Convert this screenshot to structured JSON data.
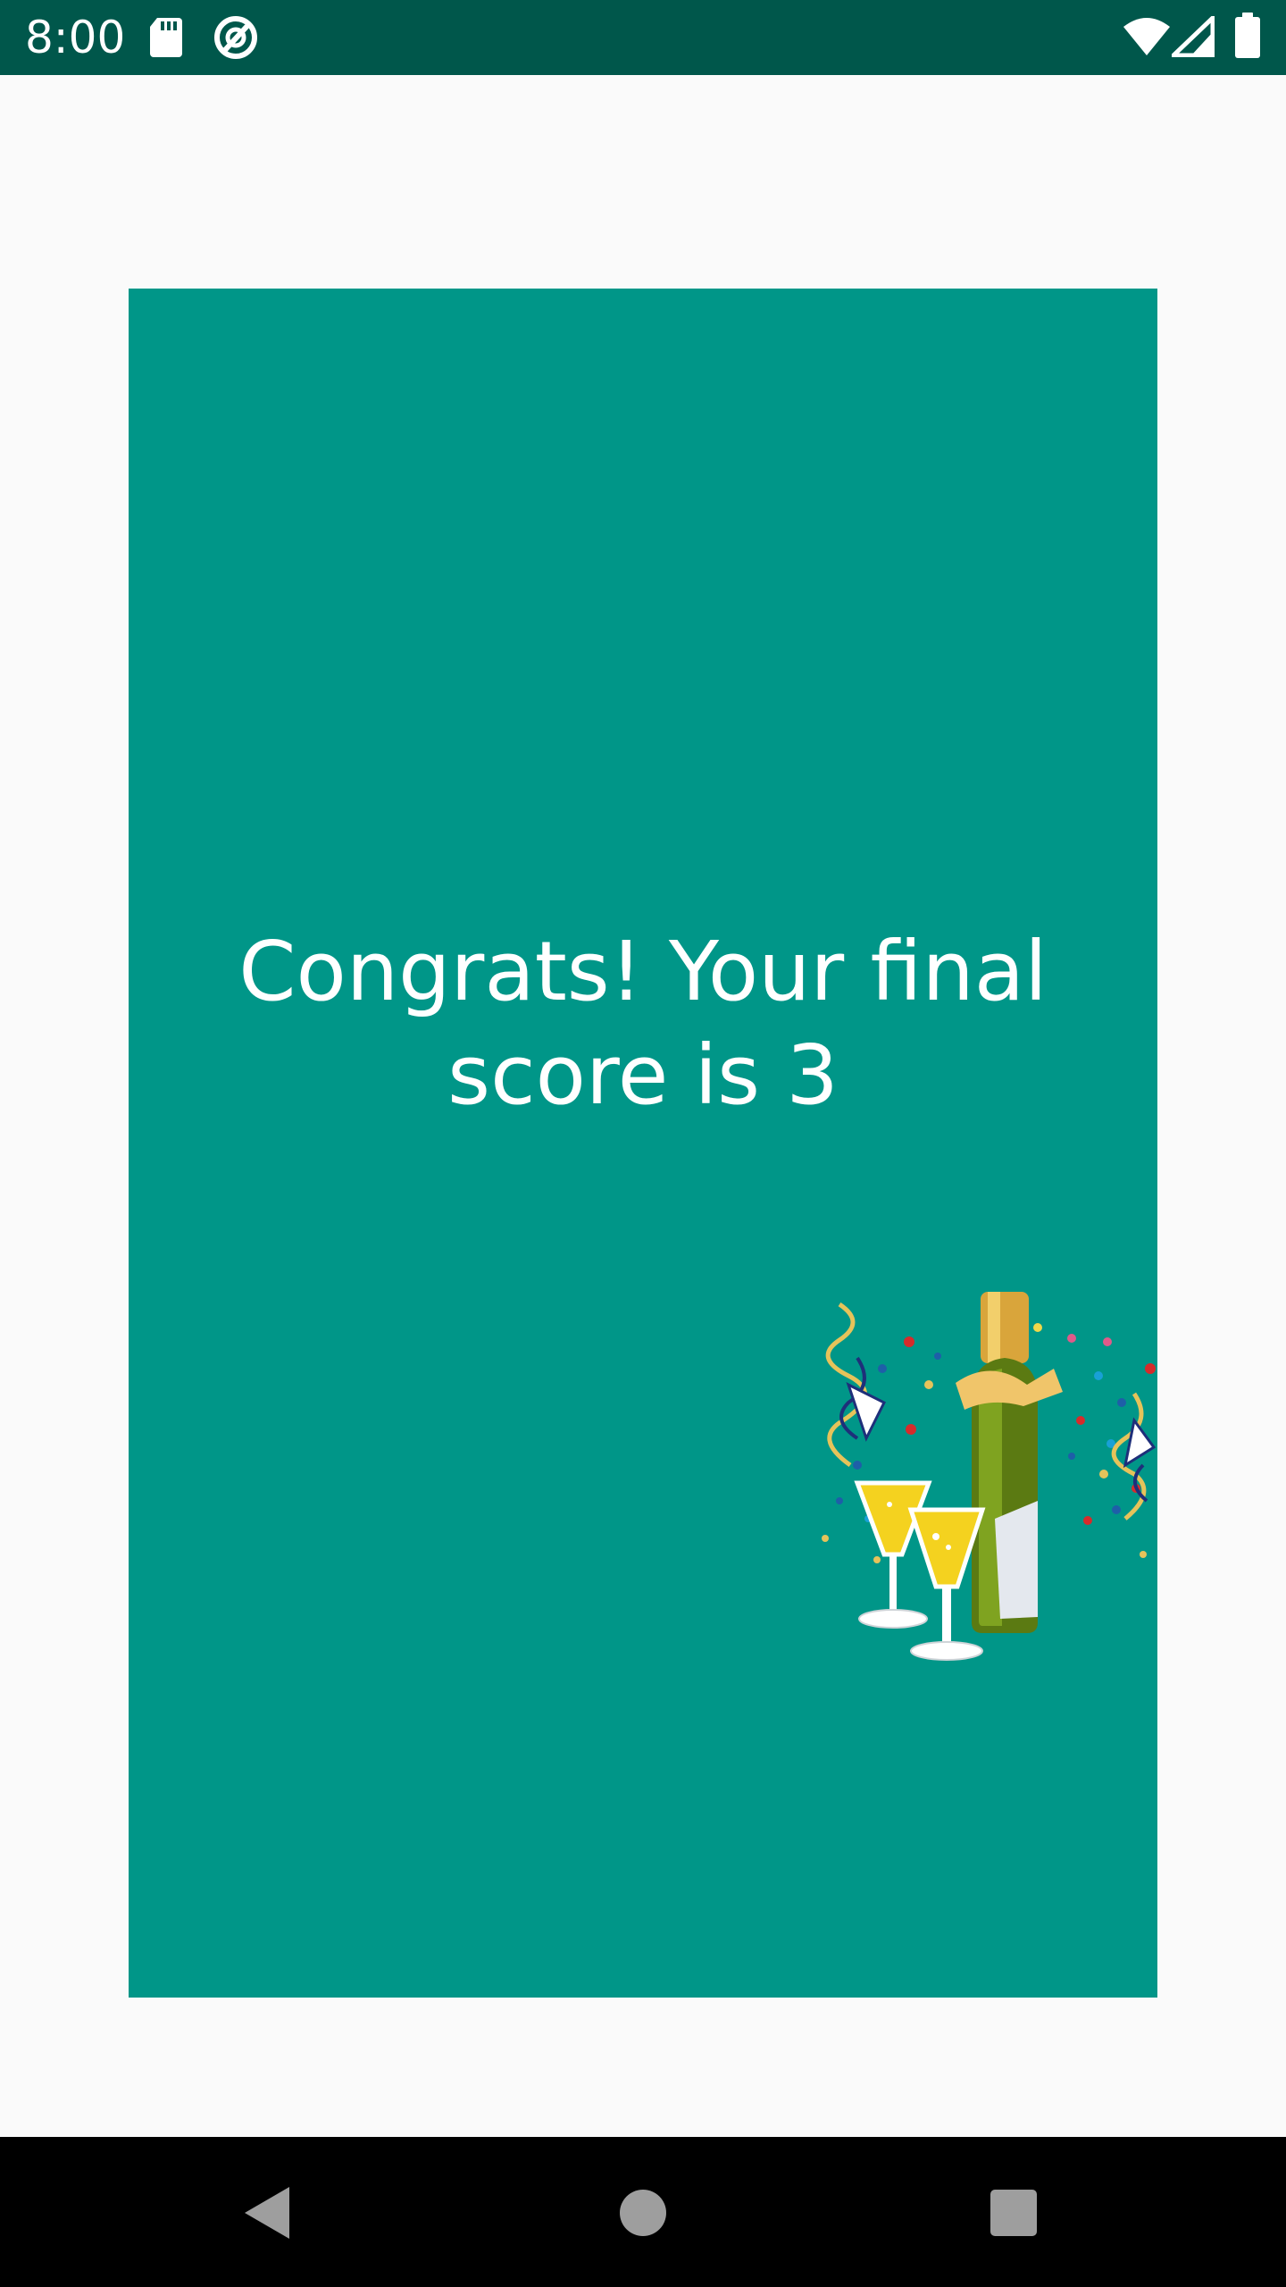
{
  "status_bar": {
    "time": "8:00",
    "icons": [
      "sd-card-icon",
      "sync-circle-icon",
      "wifi-icon",
      "signal-icon",
      "battery-icon"
    ]
  },
  "main": {
    "message": "Congrats! Your final\nscore is 3",
    "card_color": "#009688",
    "illustration": "champagne-celebration-icon"
  },
  "nav_bar": {
    "buttons": [
      "back-button",
      "home-button",
      "recents-button"
    ]
  },
  "colors": {
    "status_bar": "#00574b",
    "card": "#009688",
    "background": "#fafafa"
  }
}
